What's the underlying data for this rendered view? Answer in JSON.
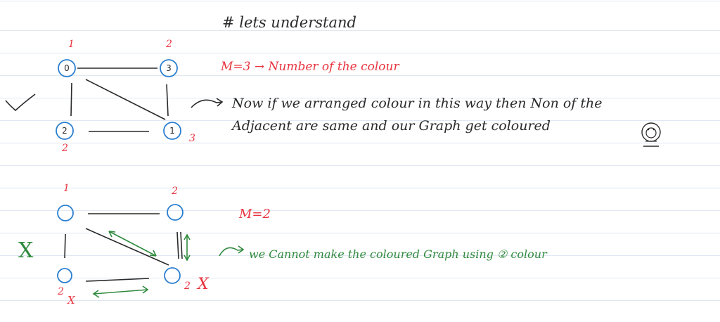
{
  "heading": "# lets understand",
  "graph1": {
    "nodes": [
      {
        "label": "0",
        "color_number": "1"
      },
      {
        "label": "3",
        "color_number": "2"
      },
      {
        "label": "2",
        "color_number": "2"
      },
      {
        "label": "1",
        "color_number": "3"
      }
    ],
    "check_mark": "✓",
    "m_statement": "M=3 → Number of the colour",
    "explanation_line1": "Now if we arranged colour in this way then Non of the",
    "explanation_line2": "Adjacent are same and our Graph get coloured",
    "emoji": "smiley-face"
  },
  "graph2": {
    "top_left_number": "1",
    "top_right_number": "2",
    "bottom_left_number": "2",
    "bottom_right_number": "2",
    "cross_mark": "X",
    "m_statement": "M=2",
    "explanation": "we Cannot make the coloured Graph using ② colour"
  },
  "colors": {
    "ink_black": "#2a2a2a",
    "ink_red": "#e8343f",
    "ink_green": "#2f8a3e",
    "node_blue": "#2b7fd0",
    "rule_line": "#dfe8f2"
  }
}
